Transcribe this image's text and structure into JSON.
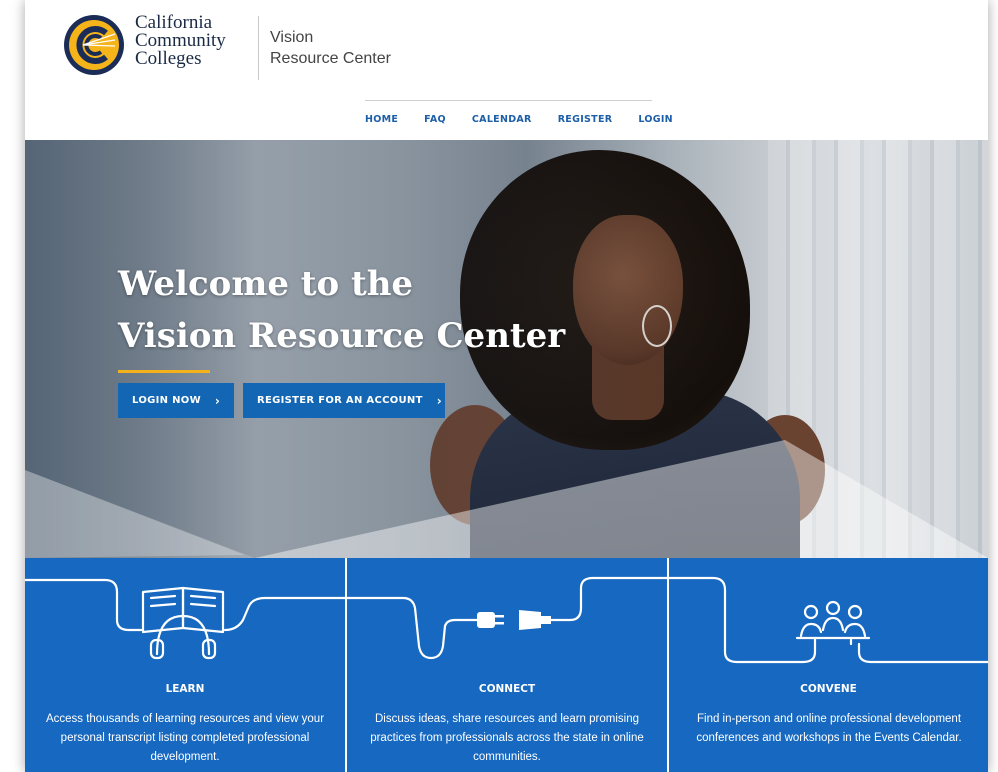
{
  "brand": {
    "org_line1": "California",
    "org_line2": "Community",
    "org_line3": "Colleges",
    "site_line1": "Vision",
    "site_line2": "Resource Center",
    "accent": "#f3b21b",
    "primary": "#1366b3"
  },
  "nav": [
    {
      "label": "HOME"
    },
    {
      "label": "FAQ"
    },
    {
      "label": "CALENDAR"
    },
    {
      "label": "REGISTER"
    },
    {
      "label": "LOGIN"
    }
  ],
  "hero": {
    "title_line1": "Welcome to the",
    "title_line2": "Vision Resource Center",
    "login_button": "LOGIN NOW",
    "register_button": "REGISTER FOR AN ACCOUNT",
    "chevron": "›"
  },
  "features": [
    {
      "icon": "book-headphones-icon",
      "title": "LEARN",
      "text": "Access thousands of learning resources and view your personal transcript listing completed professional development."
    },
    {
      "icon": "plug-connect-icon",
      "title": "CONNECT",
      "text": "Discuss ideas, share resources and learn promising practices from professionals across the state in online communities."
    },
    {
      "icon": "people-meeting-icon",
      "title": "CONVENE",
      "text": "Find in-person and online professional development conferences and workshops in the Events Calendar."
    }
  ]
}
